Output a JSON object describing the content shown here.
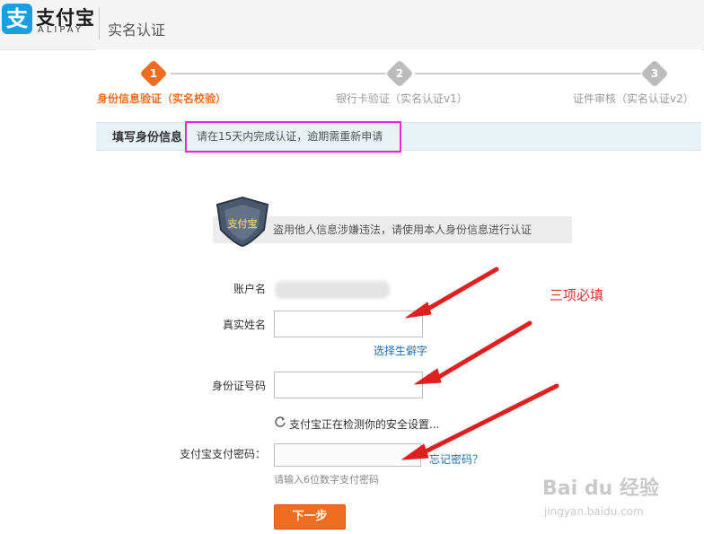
{
  "header": {
    "logo_glyph": "支",
    "logo_text_cn": "支付宝",
    "logo_text_en": "ALIPAY",
    "title": "实名认证"
  },
  "steps": [
    {
      "number": "1",
      "label": "身份信息验证（实名校验）",
      "state": "active"
    },
    {
      "number": "2",
      "label": "银行卡验证（实名认证v1）",
      "state": "inactive"
    },
    {
      "number": "3",
      "label": "证件审核（实名认证v2）",
      "state": "inactive"
    }
  ],
  "notice": {
    "title": "填写身份信息",
    "text": "请在15天内完成认证，逾期需重新申请"
  },
  "warning": {
    "shield_text": "支付宝",
    "text": "盗用他人信息涉嫌违法，请使用本人身份信息进行认证"
  },
  "form": {
    "account_label": "账户名",
    "name_label": "真实姓名",
    "rare_char_link": "选择生僻字",
    "id_label": "身份证号码",
    "security_check_text": "支付宝正在检测你的安全设置...",
    "password_label": "支付宝支付密码：",
    "forgot_password_link": "忘记密码？",
    "password_hint": "请输入6位数字支付密码",
    "submit_label": "下一步"
  },
  "annotation": {
    "required_note": "三项必填"
  },
  "watermark": {
    "brand": "Bai du 经验",
    "url": "jingyan.baidu.com"
  },
  "colors": {
    "brand_blue": "#1aa0e1",
    "accent_orange": "#ee6d20",
    "step_inactive": "#bcbcbc",
    "annotation_red": "#e03131",
    "highlight_magenta": "#e12cd8",
    "link_blue": "#1a6fb1"
  },
  "icons": {
    "logo": "alipay-logo-icon",
    "shield": "shield-icon",
    "refresh": "refresh-icon",
    "arrow": "red-arrow-icon"
  }
}
